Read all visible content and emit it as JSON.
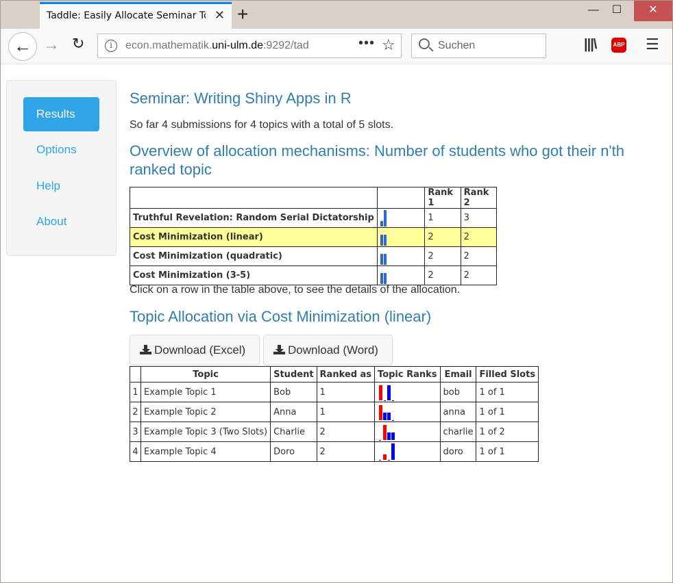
{
  "browser": {
    "tab_title": "Taddle: Easily Allocate Seminar Top",
    "url_prefix": "econ.mathematik.",
    "url_host": "uni-ulm.de",
    "url_suffix": ":9292/tad",
    "search_placeholder": "Suchen",
    "abp_label": "ABP"
  },
  "sidebar": {
    "items": [
      {
        "label": "Results",
        "active": true
      },
      {
        "label": "Options",
        "active": false
      },
      {
        "label": "Help",
        "active": false
      },
      {
        "label": "About",
        "active": false
      }
    ]
  },
  "main": {
    "title": "Seminar: Writing Shiny Apps in R",
    "summary": "So far 4 submissions for 4 topics with a total of 5 slots.",
    "overview_heading": "Overview of allocation mechanisms: Number of students who got their n'th ranked topic",
    "mechanisms": {
      "headers": [
        "",
        "",
        "Rank 1",
        "Rank 2"
      ],
      "rows": [
        {
          "name": "Truthful Revelation: Random Serial Dictatorship",
          "rank1": "1",
          "rank2": "3",
          "selected": false
        },
        {
          "name": "Cost Minimization (linear)",
          "rank1": "2",
          "rank2": "2",
          "selected": true
        },
        {
          "name": "Cost Minimization (quadratic)",
          "rank1": "2",
          "rank2": "2",
          "selected": false
        },
        {
          "name": "Cost Minimization (3-5)",
          "rank1": "2",
          "rank2": "2",
          "selected": false
        }
      ]
    },
    "click_hint": "Click on a row in the table above, to see the details of the allocation.",
    "allocation_heading": "Topic Allocation via Cost Minimization (linear)",
    "download_excel": "Download (Excel)",
    "download_word": "Download (Word)",
    "allocation": {
      "headers": [
        "",
        "Topic",
        "Student",
        "Ranked as",
        "Topic Ranks",
        "Email",
        "Filled Slots"
      ],
      "rows": [
        {
          "idx": "1",
          "topic": "Example Topic 1",
          "student": "Bob",
          "ranked_as": "1",
          "email": "bob",
          "filled": "1 of 1"
        },
        {
          "idx": "2",
          "topic": "Example Topic 2",
          "student": "Anna",
          "ranked_as": "1",
          "email": "anna",
          "filled": "1 of 1"
        },
        {
          "idx": "3",
          "topic": "Example Topic 3 (Two Slots)",
          "student": "Charlie",
          "ranked_as": "2",
          "email": "charlie",
          "filled": "1 of 2"
        },
        {
          "idx": "4",
          "topic": "Example Topic 4",
          "student": "Doro",
          "ranked_as": "2",
          "email": "doro",
          "filled": "1 of 1"
        }
      ]
    }
  },
  "colors": {
    "accent": "#2fa4e7",
    "heading": "#317eac",
    "highlight_row": "#ffff99",
    "sparkbar": "#3366cc",
    "rank_selected": "#ff0000",
    "rank_other": "#0000ff"
  },
  "icons": [
    "info-icon",
    "star-icon",
    "search-icon",
    "library-icon",
    "menu-icon",
    "download-icon"
  ]
}
